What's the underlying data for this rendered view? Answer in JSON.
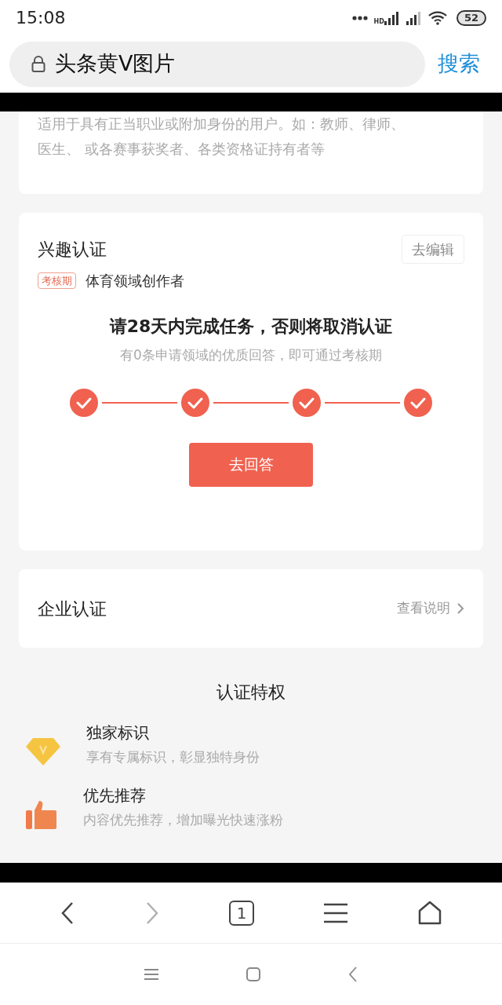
{
  "status_bar": {
    "time": "15:08",
    "network": "HD",
    "battery": "52"
  },
  "search_bar": {
    "query": "头条黄V图片",
    "button": "搜索"
  },
  "cards": [
    {
      "kind": "description",
      "text": "适用于具有正当职业或附加身份的用户。如：教师、律师、医生、 或各赛事获奖者、各类资格证持有者等"
    },
    {
      "kind": "interest",
      "title": "兴趣认证",
      "edit_button": "去编辑",
      "tag": "考核期",
      "field": "体育领域创作者",
      "headline": "请28天内完成任务，否则将取消认证",
      "subtitle": "有0条申请领域的优质回答，即可通过考核期",
      "steps": [
        {
          "done": true
        },
        {
          "done": true
        },
        {
          "done": true
        },
        {
          "done": true
        }
      ],
      "action_button": "去回答"
    },
    {
      "kind": "enterprise",
      "title": "企业认证",
      "link": "查看说明"
    }
  ],
  "privileges": {
    "title": "认证特权",
    "items": [
      {
        "kind": "badge",
        "title": "独家标识",
        "text": "享有专属标识，彰显独特身份"
      },
      {
        "kind": "recommend",
        "title": "优先推荐",
        "text": "内容优先推荐，增加曝光快速涨粉"
      }
    ]
  },
  "browser_nav": {
    "back_disabled": false,
    "forward_disabled": true,
    "tab_count": "1"
  }
}
